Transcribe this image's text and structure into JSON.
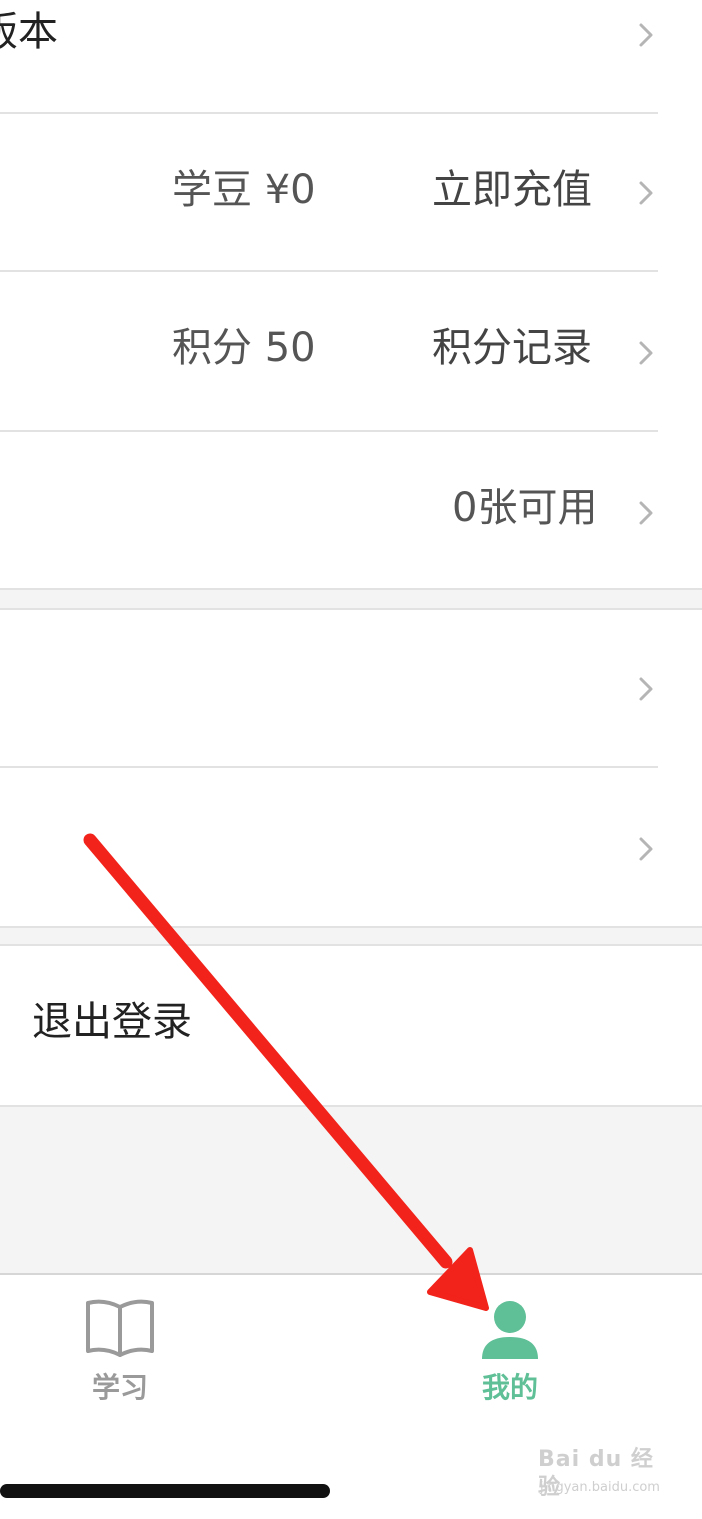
{
  "rows": {
    "version": {
      "label": "版本"
    },
    "beans": {
      "value": "学豆 ¥0",
      "action": "立即充值"
    },
    "points": {
      "value": "积分 50",
      "action": "积分记录"
    },
    "coupons": {
      "value": "0张可用"
    },
    "logout": {
      "label": "退出登录"
    }
  },
  "tabbar": {
    "study": {
      "label": "学习",
      "icon": "book-icon",
      "color": "#9a9a9a"
    },
    "mine": {
      "label": "我的",
      "icon": "user-icon",
      "color": "#5fbf97",
      "active": true
    }
  },
  "colors": {
    "accent": "#5fbf97",
    "arrow": "#f2231b",
    "divider": "#e2e2e2",
    "section_bg": "#f4f4f4"
  },
  "watermark": {
    "brand": "Bai du 经验",
    "url": "jingyan.baidu.com"
  }
}
